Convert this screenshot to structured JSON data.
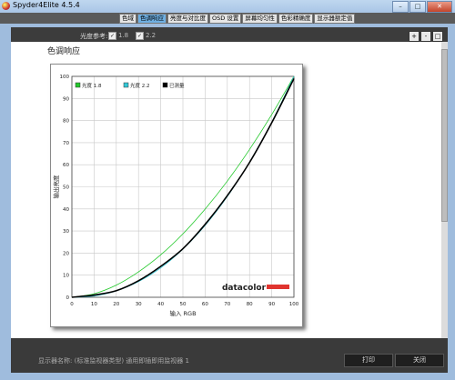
{
  "window": {
    "title": "Spyder4Elite 4.5.4",
    "min": "–",
    "max": "□",
    "close": "✕"
  },
  "tabs": [
    {
      "label": "色域",
      "active": false
    },
    {
      "label": "色调响应",
      "active": true
    },
    {
      "label": "亮度与对比度",
      "active": false
    },
    {
      "label": "OSD 设置",
      "active": false
    },
    {
      "label": "屏幕均匀性",
      "active": false
    },
    {
      "label": "色彩精确度",
      "active": false
    },
    {
      "label": "显示器额定值",
      "active": false
    }
  ],
  "toolbar": {
    "gamma_ref_label": "光度参考:",
    "options": [
      {
        "label": "1.8",
        "checked": true
      },
      {
        "label": "2.2",
        "checked": true
      }
    ],
    "zoom_in": "+",
    "zoom_out": "-",
    "zoom_fit": "□"
  },
  "section_title": "色调响应",
  "chart_data": {
    "type": "line",
    "xlabel": "输入 RGB",
    "ylabel": "输出亮度",
    "xlim": [
      0,
      100
    ],
    "ylim": [
      0,
      100
    ],
    "x_ticks": [
      0,
      10,
      20,
      30,
      40,
      50,
      60,
      70,
      80,
      90,
      100
    ],
    "y_ticks": [
      0,
      10,
      20,
      30,
      40,
      50,
      60,
      70,
      80,
      90,
      100
    ],
    "grid": true,
    "legend_position": "top-left",
    "logo": "datacolor",
    "series": [
      {
        "name": "光度 1.8",
        "color": "#22c82a",
        "x": [
          0,
          10,
          20,
          30,
          40,
          50,
          60,
          70,
          80,
          90,
          100
        ],
        "y": [
          0,
          1.6,
          5.5,
          11.5,
          19.2,
          28.7,
          39.9,
          52.6,
          66.9,
          82.7,
          100
        ]
      },
      {
        "name": "光度 2.2",
        "color": "#33c8d6",
        "x": [
          0,
          10,
          20,
          30,
          40,
          50,
          60,
          70,
          80,
          90,
          100
        ],
        "y": [
          0,
          0.6,
          2.9,
          7.1,
          13.3,
          21.8,
          32.5,
          45.6,
          61.2,
          79.3,
          100
        ]
      },
      {
        "name": "已测量",
        "color": "#000000",
        "x": [
          0,
          5,
          10,
          20,
          30,
          40,
          50,
          60,
          70,
          80,
          90,
          100
        ],
        "y": [
          0,
          0.5,
          1,
          3,
          7.5,
          14,
          22,
          33,
          46,
          61,
          79,
          99
        ]
      }
    ]
  },
  "footer": {
    "status": "显示器名称: (标准监视器类型) 通用即插即用监视器 1",
    "print_label": "打印",
    "close_label": "关闭"
  }
}
